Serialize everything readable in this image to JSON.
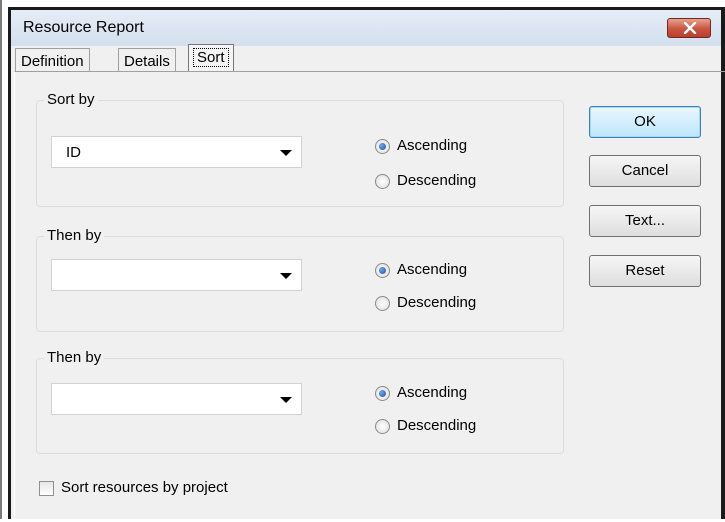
{
  "window": {
    "title": "Resource Report"
  },
  "tabs": [
    {
      "label": "Definition",
      "active": false
    },
    {
      "label": "Details",
      "active": false
    },
    {
      "label": "Sort",
      "active": true
    }
  ],
  "groups": [
    {
      "legend": "Sort by",
      "combo_value": "ID",
      "asc_label": "Ascending",
      "desc_label": "Descending",
      "selected": "Ascending"
    },
    {
      "legend": "Then by",
      "combo_value": "",
      "asc_label": "Ascending",
      "desc_label": "Descending",
      "selected": "Ascending"
    },
    {
      "legend": "Then by",
      "combo_value": "",
      "asc_label": "Ascending",
      "desc_label": "Descending",
      "selected": "Ascending"
    }
  ],
  "buttons": {
    "ok": "OK",
    "cancel": "Cancel",
    "text": "Text...",
    "reset": "Reset"
  },
  "checkbox": {
    "label": "Sort resources by project",
    "checked": false
  },
  "icons": {
    "close": "close-icon",
    "dropdown": "chevron-down-icon"
  },
  "colors": {
    "close_button": "#c8553f",
    "default_button_border": "#3c7fb1",
    "radio_dot": "#1b4f9c"
  }
}
